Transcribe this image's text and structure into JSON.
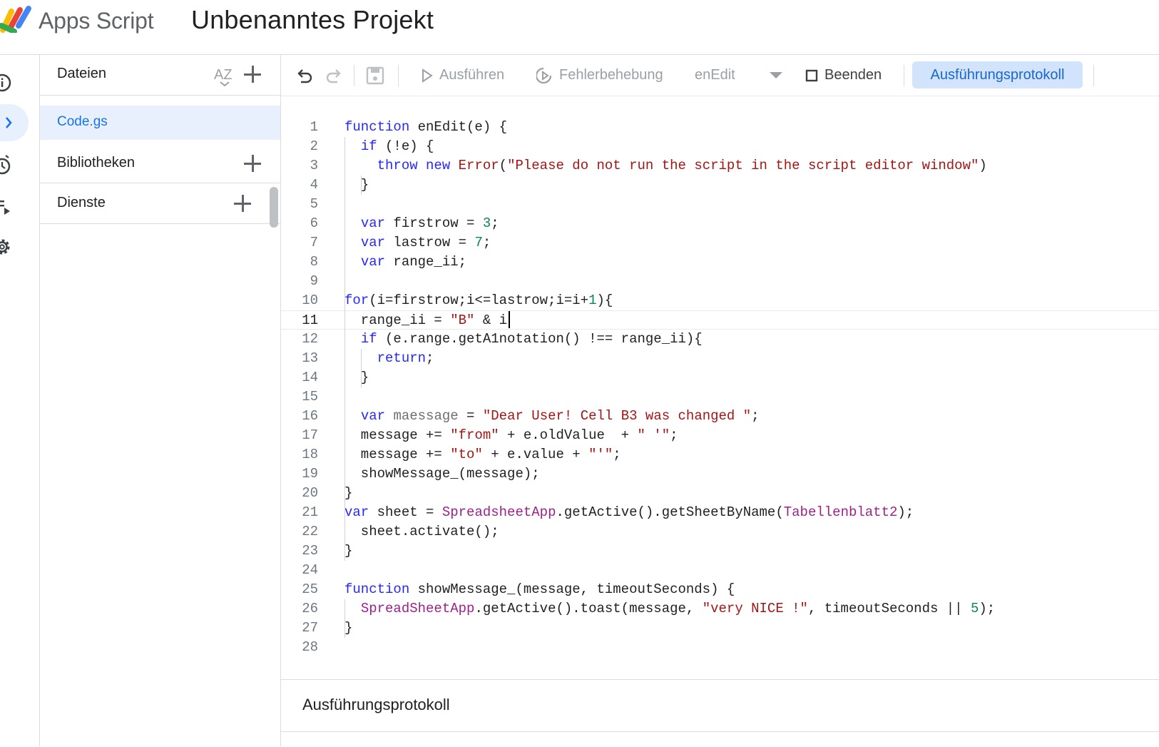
{
  "header": {
    "app_name": "Apps Script",
    "project_title": "Unbenanntes Projekt"
  },
  "rail": {
    "items": [
      "info-icon",
      "code-icon",
      "clock-icon",
      "executions-icon",
      "settings-icon"
    ],
    "active": "code-icon"
  },
  "files_panel": {
    "files_label": "Dateien",
    "sort_icon_text": "AZ",
    "files": [
      "Code.gs"
    ],
    "libraries_label": "Bibliotheken",
    "services_label": "Dienste"
  },
  "toolbar": {
    "run_label": "Ausführen",
    "debug_label": "Fehlerbehebung",
    "function_select": "enEdit",
    "stop_label": "Beenden",
    "log_label": "Ausführungsprotokoll"
  },
  "editor": {
    "current_line": 11,
    "lines": [
      "function enEdit(e) {",
      "  if (!e) {",
      "    throw new Error(\"Please do not run the script in the script editor window\")",
      "  }",
      "",
      "  var firstrow = 3;",
      "  var lastrow = 7;",
      "  var range_ii;",
      "",
      "for(i=firstrow;i<=lastrow;i=i+1){",
      "  range_ii = \"B\" & i",
      "  if (e.range.getA1notation() !== range_ii){",
      "    return;",
      "  }",
      "",
      "  var maessage = \"Dear User! Cell B3 was changed \";",
      "  message += \"from\" + e.oldValue  + \" '\";",
      "  message += \"to\" + e.value + \"'\";",
      "  showMessage_(message);",
      "}",
      "var sheet = SpreadsheetApp.getActive().getSheetByName(Tabellenblatt2);",
      "  sheet.activate();",
      "}",
      "",
      "function showMessage_(message, timeoutSeconds) {",
      "  SpreadSheetApp.getActive().toast(message, \"very NICE !\", timeoutSeconds || 5);",
      "}",
      ""
    ]
  },
  "bottom_panel": {
    "title": "Ausführungsprotokoll"
  },
  "colors": {
    "accent": "#1a73e8",
    "selected_bg": "#e8f0fe",
    "log_button_bg": "#d2e3fc"
  }
}
